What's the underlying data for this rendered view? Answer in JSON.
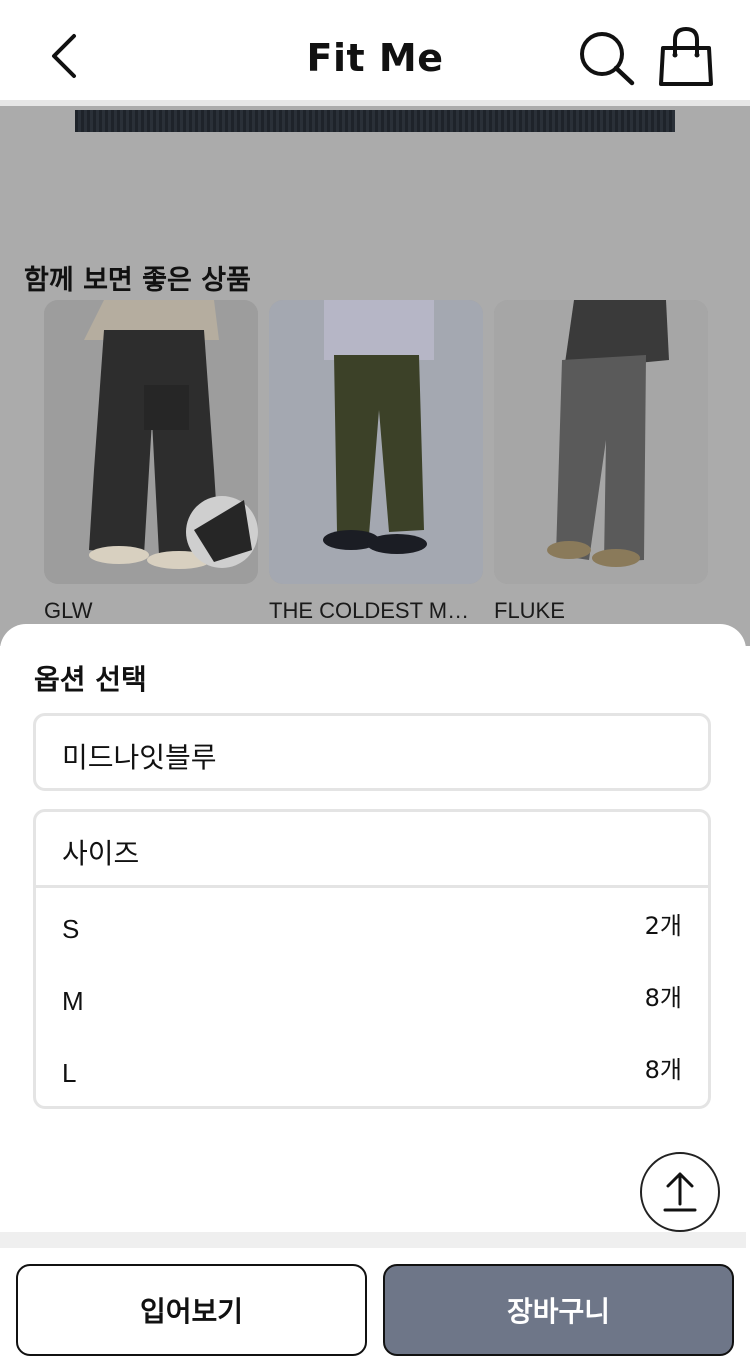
{
  "header": {
    "title": "Fit Me",
    "back_icon": "chevron-left-icon",
    "search_icon": "search-icon",
    "bag_icon": "shopping-bag-icon"
  },
  "recommendations": {
    "title": "함께 보면 좋은 상품",
    "items": [
      {
        "name": "GLW"
      },
      {
        "name": "THE COLDEST MOMENT"
      },
      {
        "name": "FLUKE"
      }
    ]
  },
  "options": {
    "title": "옵션 선택",
    "color_value": "미드나잇블루",
    "size_label": "사이즈",
    "sizes": [
      {
        "label": "S",
        "stock": "2개"
      },
      {
        "label": "M",
        "stock": "8개"
      },
      {
        "label": "L",
        "stock": "8개"
      }
    ]
  },
  "actions": {
    "try_on": "입어보기",
    "add_to_cart": "장바구니"
  },
  "colors": {
    "cart_button": "#6e7688",
    "overlay": "#ababab"
  }
}
